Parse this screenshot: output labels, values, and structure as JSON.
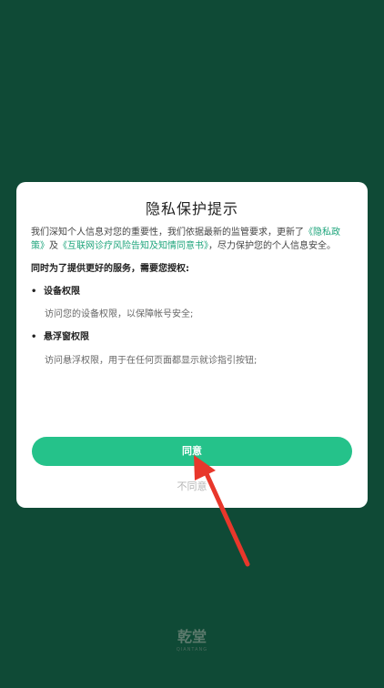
{
  "dialog": {
    "title": "隐私保护提示",
    "intro_before": "我们深知个人信息对您的重要性，我们依据最新的监管要求，更新了",
    "link_privacy": "《隐私政策》",
    "intro_and": "及",
    "link_consent": "《互联网诊疗风险告知及知情同意书》",
    "intro_after": "，尽力保护您的个人信息安全。",
    "sub_heading": "同时为了提供更好的服务，需要您授权:",
    "permissions": [
      {
        "title": "设备权限",
        "description": "访问您的设备权限，以保障帐号安全;"
      },
      {
        "title": "悬浮窗权限",
        "description": "访问悬浮权限，用于在任何页面都显示就诊指引按钮;"
      }
    ],
    "agree_label": "同意",
    "disagree_label": "不同意"
  },
  "brand": {
    "logo": "乾堂",
    "subtitle": "QIANTANG"
  },
  "colors": {
    "background": "#0f4a36",
    "accent": "#25c28a",
    "link": "#1fa57c",
    "arrow": "#e8372b"
  },
  "icons": {
    "bullet": "•"
  }
}
